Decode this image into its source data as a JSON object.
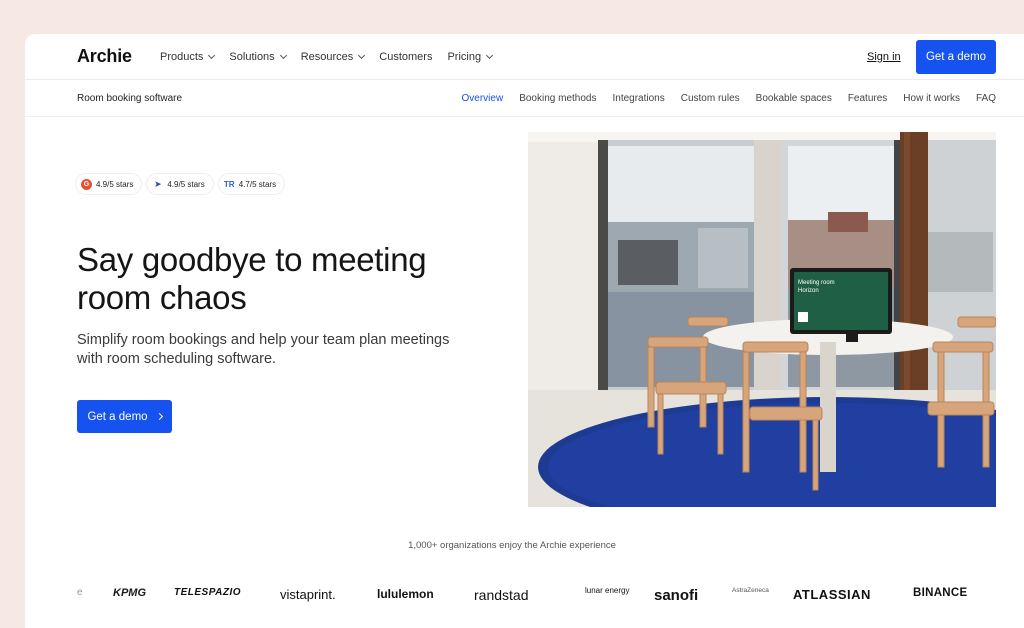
{
  "nav": {
    "logo": "Archie",
    "menu": [
      "Products",
      "Solutions",
      "Resources",
      "Customers",
      "Pricing"
    ],
    "signin": "Sign in",
    "cta": "Get a demo"
  },
  "subnav": {
    "title": "Room booking software",
    "links": [
      "Overview",
      "Booking methods",
      "Integrations",
      "Custom rules",
      "Bookable spaces",
      "Features",
      "How it works",
      "FAQ"
    ],
    "active": "Overview"
  },
  "ratings": [
    {
      "icon": "g2-icon",
      "text": "4.9/5 stars"
    },
    {
      "icon": "capterra-icon",
      "text": "4.9/5 stars"
    },
    {
      "icon": "trustradius-icon",
      "text": "4.7/5 stars"
    }
  ],
  "hero": {
    "title_line1": "Say goodbye to meeting",
    "title_line2": "room chaos",
    "subtitle_line1": "Simplify room bookings and help your team plan meetings",
    "subtitle_line2": "with room scheduling software.",
    "cta": "Get a demo"
  },
  "photo": {
    "screen_text_line1": "Meeting room",
    "screen_text_line2": "Horizon"
  },
  "trust": {
    "text": "1,000+ organizations enjoy the Archie experience",
    "logos": [
      "e",
      "KPMG",
      "TELESPAZIO",
      "vistaprint.",
      "lululemon",
      "randstad",
      "lunar energy",
      "sanofi",
      "AstraZeneca",
      "ATLASSIAN",
      "BINANCE"
    ]
  },
  "colors": {
    "accent": "#1652f0",
    "page_bg": "#f6e9e4"
  }
}
